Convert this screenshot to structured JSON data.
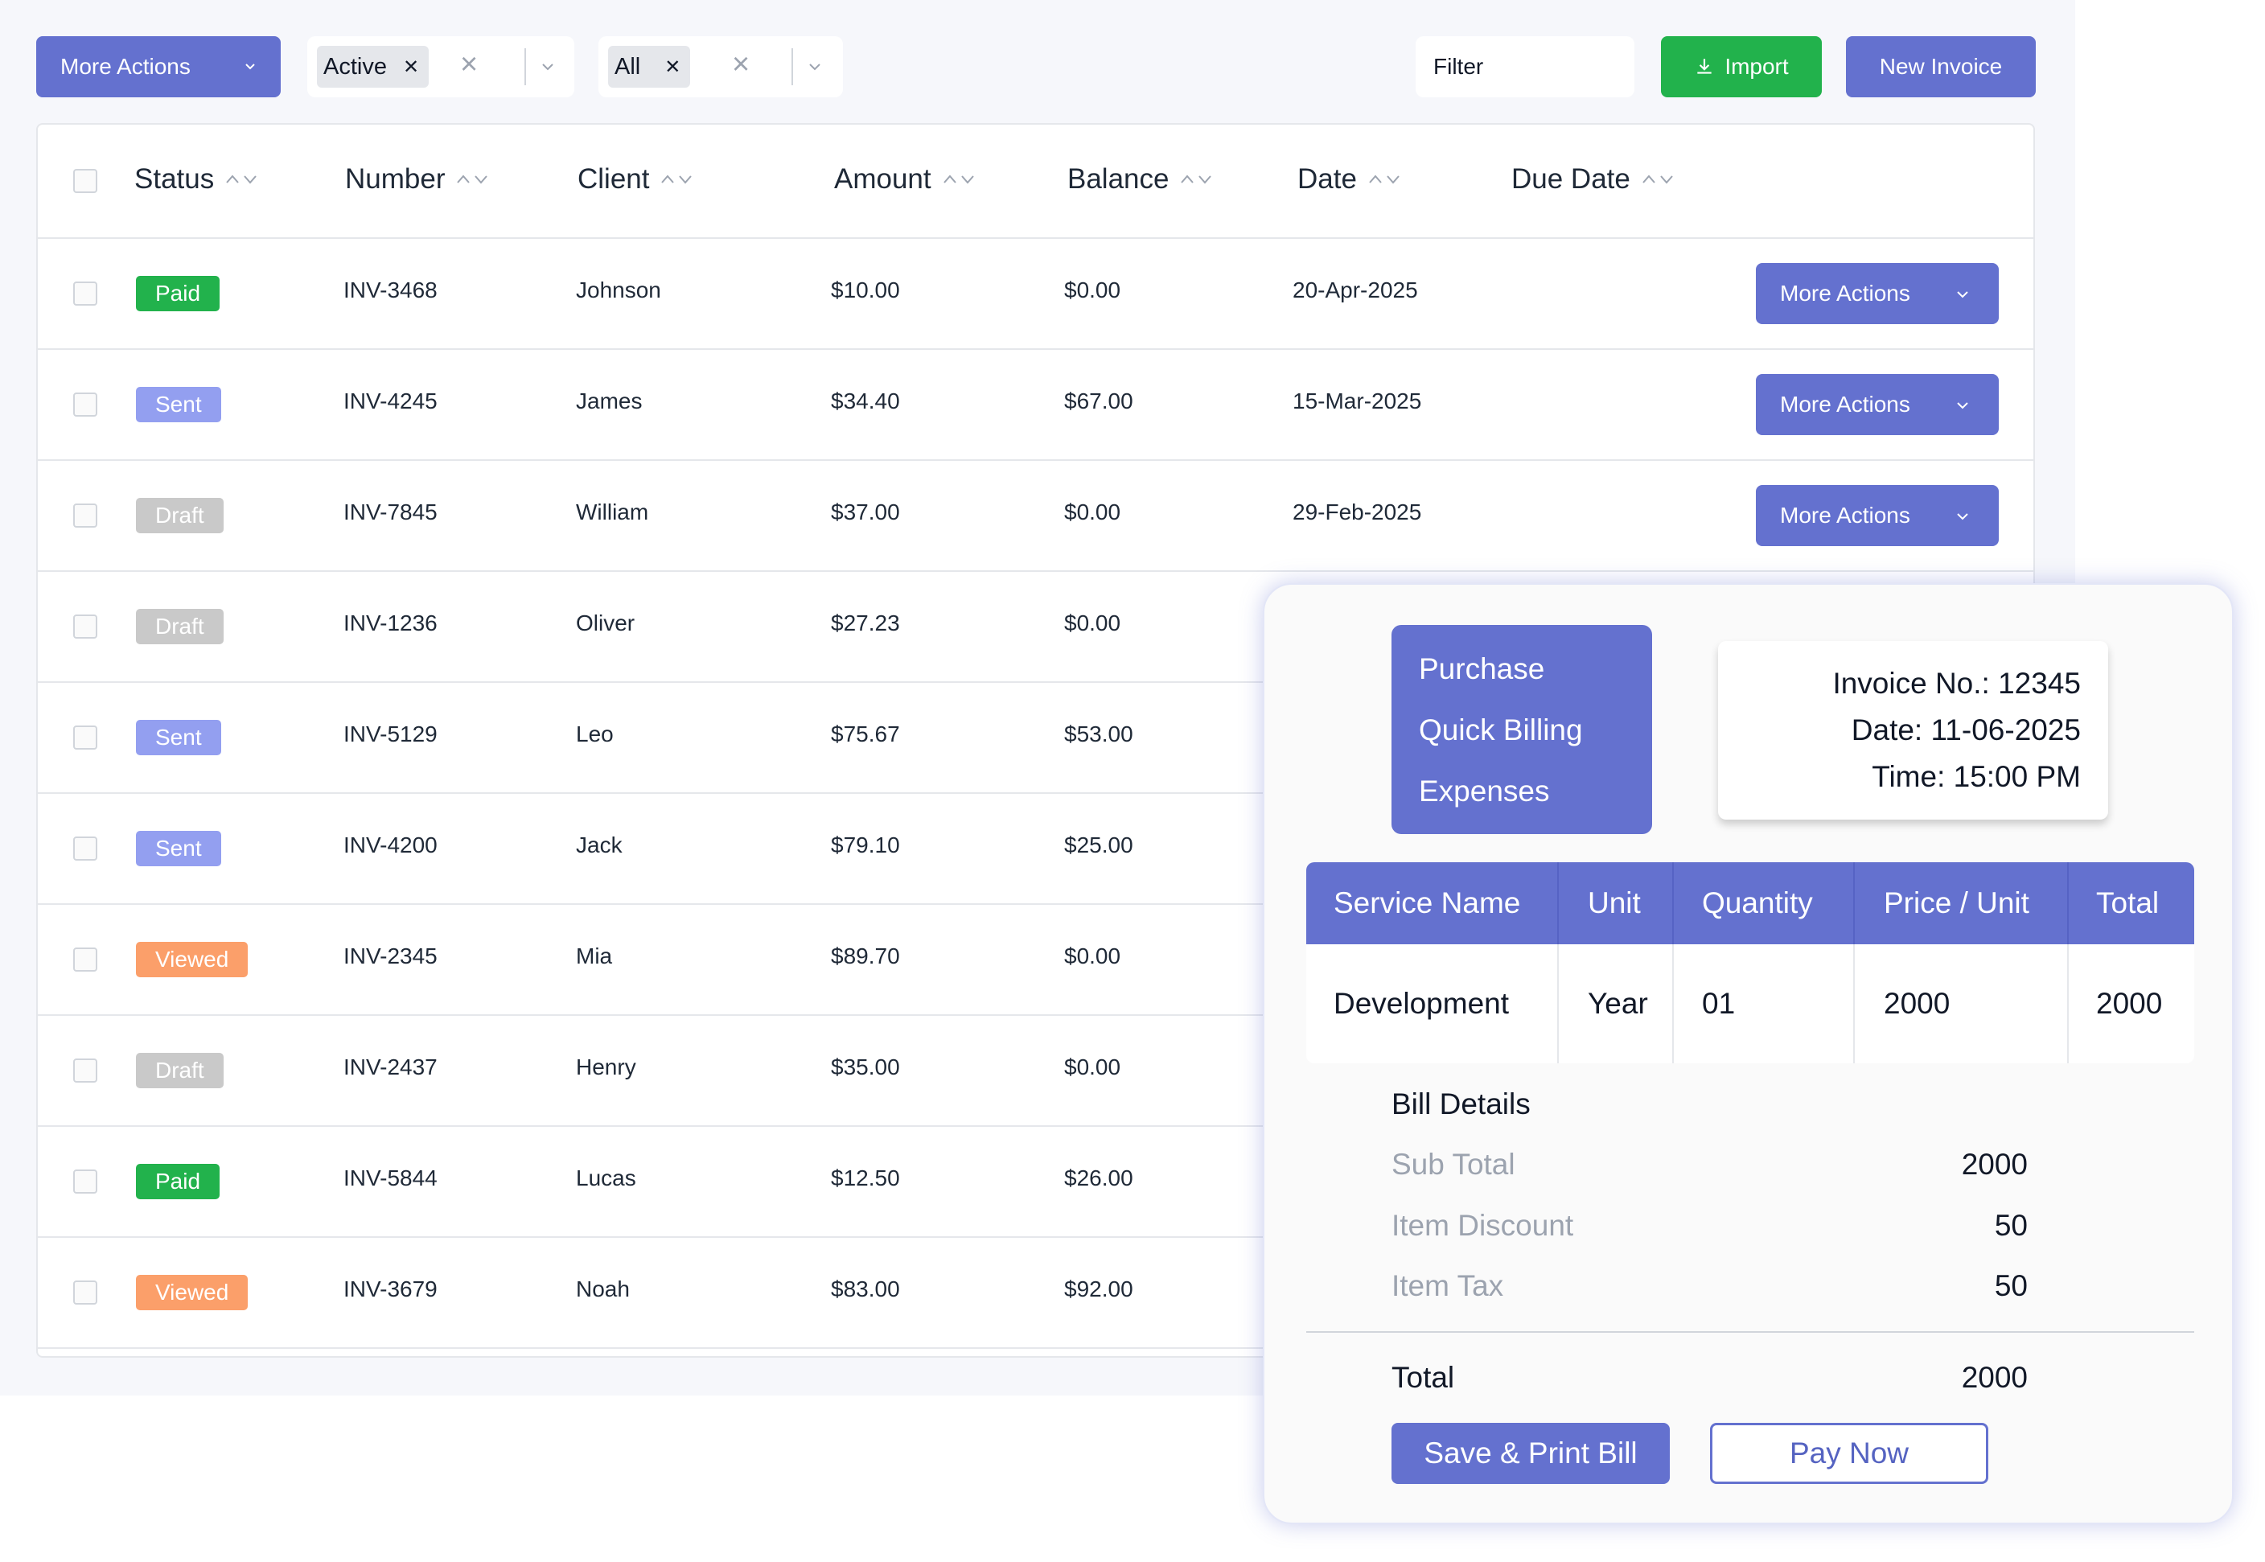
{
  "toolbar": {
    "more_actions_label": "More Actions",
    "status_filter_tag": "Active",
    "type_filter_tag": "All",
    "filter_placeholder": "Filter",
    "import_label": "Import",
    "new_invoice_label": "New Invoice"
  },
  "table": {
    "columns": [
      "Status",
      "Number",
      "Client",
      "Amount",
      "Balance",
      "Date",
      "Due Date"
    ],
    "row_action_label": "More Actions",
    "rows": [
      {
        "status": "Paid",
        "number": "INV-3468",
        "client": "Johnson",
        "amount": "$10.00",
        "balance": "$0.00",
        "date": "20-Apr-2025"
      },
      {
        "status": "Sent",
        "number": "INV-4245",
        "client": "James",
        "amount": "$34.40",
        "balance": "$67.00",
        "date": "15-Mar-2025"
      },
      {
        "status": "Draft",
        "number": "INV-7845",
        "client": "William",
        "amount": "$37.00",
        "balance": "$0.00",
        "date": "29-Feb-2025"
      },
      {
        "status": "Draft",
        "number": "INV-1236",
        "client": "Oliver",
        "amount": "$27.23",
        "balance": "$0.00",
        "date": ""
      },
      {
        "status": "Sent",
        "number": "INV-5129",
        "client": "Leo",
        "amount": "$75.67",
        "balance": "$53.00",
        "date": ""
      },
      {
        "status": "Sent",
        "number": "INV-4200",
        "client": "Jack",
        "amount": "$79.10",
        "balance": "$25.00",
        "date": ""
      },
      {
        "status": "Viewed",
        "number": "INV-2345",
        "client": "Mia",
        "amount": "$89.70",
        "balance": "$0.00",
        "date": ""
      },
      {
        "status": "Draft",
        "number": "INV-2437",
        "client": "Henry",
        "amount": "$35.00",
        "balance": "$0.00",
        "date": ""
      },
      {
        "status": "Paid",
        "number": "INV-5844",
        "client": "Lucas",
        "amount": "$12.50",
        "balance": "$26.00",
        "date": ""
      },
      {
        "status": "Viewed",
        "number": "INV-3679",
        "client": "Noah",
        "amount": "$83.00",
        "balance": "$92.00",
        "date": ""
      }
    ]
  },
  "status_colors": {
    "Paid": "#22b24c",
    "Sent": "#939ff0",
    "Draft": "#c9c9c9",
    "Viewed": "#fb9f6a"
  },
  "accent_color": "#6471cf",
  "invoice_card": {
    "menu": [
      "Purchase",
      "Quick Billing",
      "Expenses"
    ],
    "invoice_no": "Invoice No.: 12345",
    "date": "Date: 11-06-2025",
    "time": "Time: 15:00 PM",
    "service_table": {
      "headers": [
        "Service Name",
        "Unit",
        "Quantity",
        "Price / Unit",
        "Total"
      ],
      "row": [
        "Development",
        "Year",
        "01",
        "2000",
        "2000"
      ]
    },
    "bill_details_title": "Bill Details",
    "sub_total_label": "Sub Total",
    "sub_total_value": "2000",
    "item_discount_label": "Item Discount",
    "item_discount_value": "50",
    "item_tax_label": "Item Tax",
    "item_tax_value": "50",
    "total_label": "Total",
    "total_value": "2000",
    "save_print_label": "Save & Print Bill",
    "pay_now_label": "Pay Now"
  }
}
